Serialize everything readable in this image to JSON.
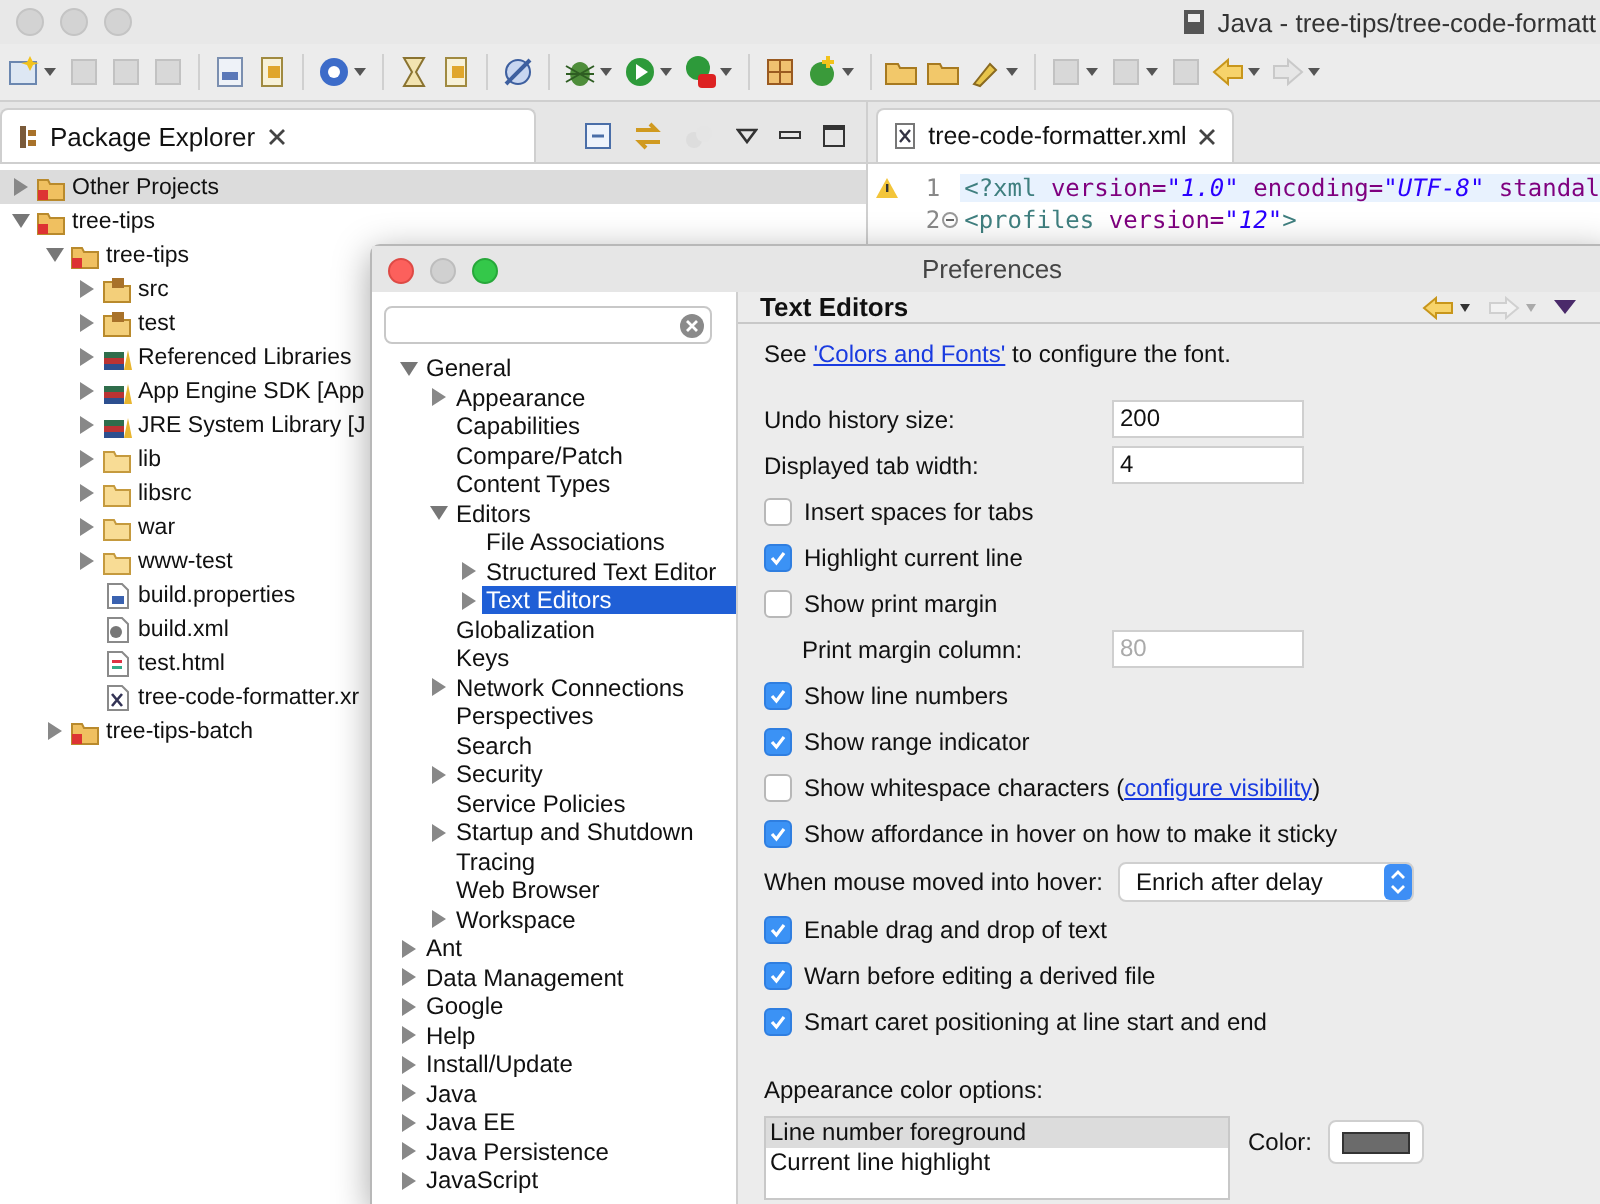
{
  "window": {
    "title": "Java - tree-tips/tree-code-formatt"
  },
  "package_explorer": {
    "title": "Package Explorer",
    "tree": [
      {
        "label": "Other Projects",
        "kind": "working-set",
        "expanded": false,
        "selected": true
      },
      {
        "label": "tree-tips",
        "kind": "working-set",
        "expanded": true,
        "selected": false,
        "children": [
          {
            "label": "tree-tips",
            "kind": "project",
            "expanded": true,
            "selected": false,
            "children": [
              {
                "label": "src",
                "kind": "source-folder",
                "expanded": false,
                "selected": false
              },
              {
                "label": "test",
                "kind": "source-folder",
                "expanded": false,
                "selected": false
              },
              {
                "label": "Referenced Libraries",
                "kind": "library",
                "expanded": false,
                "selected": false
              },
              {
                "label": "App Engine SDK [App",
                "kind": "library",
                "expanded": false,
                "selected": false
              },
              {
                "label": "JRE System Library [J",
                "kind": "library",
                "expanded": false,
                "selected": false
              },
              {
                "label": "lib",
                "kind": "folder",
                "expanded": false,
                "selected": false
              },
              {
                "label": "libsrc",
                "kind": "folder",
                "expanded": false,
                "selected": false
              },
              {
                "label": "war",
                "kind": "folder",
                "expanded": false,
                "selected": false
              },
              {
                "label": "www-test",
                "kind": "folder",
                "expanded": false,
                "selected": false
              },
              {
                "label": "build.properties",
                "kind": "properties-file",
                "selected": false
              },
              {
                "label": "build.xml",
                "kind": "build-file",
                "selected": false
              },
              {
                "label": "test.html",
                "kind": "html-file",
                "selected": false
              },
              {
                "label": "tree-code-formatter.xr",
                "kind": "xml-file",
                "selected": false
              }
            ]
          },
          {
            "label": "tree-tips-batch",
            "kind": "project",
            "expanded": false,
            "selected": false
          }
        ]
      }
    ]
  },
  "editor": {
    "tab": "tree-code-formatter.xml",
    "lines": [
      {
        "number": "1",
        "highlighted": true,
        "warning": true,
        "foldable": false,
        "tokens": [
          {
            "text": "<?xml",
            "kind": "tag"
          },
          {
            "text": " version=",
            "kind": "attr"
          },
          {
            "text": "\"1.0\"",
            "kind": "string"
          },
          {
            "text": " encoding=",
            "kind": "attr"
          },
          {
            "text": "\"UTF-8\"",
            "kind": "string"
          },
          {
            "text": " standal",
            "kind": "attr"
          }
        ]
      },
      {
        "number": "2",
        "highlighted": false,
        "warning": false,
        "foldable": true,
        "tokens": [
          {
            "text": "<profiles",
            "kind": "tag"
          },
          {
            "text": " version=",
            "kind": "attr"
          },
          {
            "text": "\"12\"",
            "kind": "string"
          },
          {
            "text": ">",
            "kind": "tag"
          }
        ]
      }
    ]
  },
  "preferences": {
    "title": "Preferences",
    "tree": [
      {
        "label": "General",
        "expanded": true,
        "selected": false,
        "children": [
          {
            "label": "Appearance",
            "expanded": false,
            "selected": false
          },
          {
            "label": "Capabilities",
            "selected": false
          },
          {
            "label": "Compare/Patch",
            "selected": false
          },
          {
            "label": "Content Types",
            "selected": false
          },
          {
            "label": "Editors",
            "expanded": true,
            "selected": false,
            "children": [
              {
                "label": "File Associations",
                "selected": false
              },
              {
                "label": "Structured Text Editor",
                "expanded": false,
                "selected": false
              },
              {
                "label": "Text Editors",
                "expanded": false,
                "selected": true
              }
            ]
          },
          {
            "label": "Globalization",
            "selected": false
          },
          {
            "label": "Keys",
            "selected": false
          },
          {
            "label": "Network Connections",
            "expanded": false,
            "selected": false
          },
          {
            "label": "Perspectives",
            "selected": false
          },
          {
            "label": "Search",
            "selected": false
          },
          {
            "label": "Security",
            "expanded": false,
            "selected": false
          },
          {
            "label": "Service Policies",
            "selected": false
          },
          {
            "label": "Startup and Shutdown",
            "expanded": false,
            "selected": false
          },
          {
            "label": "Tracing",
            "selected": false
          },
          {
            "label": "Web Browser",
            "selected": false
          },
          {
            "label": "Workspace",
            "expanded": false,
            "selected": false
          }
        ]
      },
      {
        "label": "Ant",
        "expanded": false,
        "selected": false
      },
      {
        "label": "Data Management",
        "expanded": false,
        "selected": false
      },
      {
        "label": "Google",
        "expanded": false,
        "selected": false
      },
      {
        "label": "Help",
        "expanded": false,
        "selected": false
      },
      {
        "label": "Install/Update",
        "expanded": false,
        "selected": false
      },
      {
        "label": "Java",
        "expanded": false,
        "selected": false
      },
      {
        "label": "Java EE",
        "expanded": false,
        "selected": false
      },
      {
        "label": "Java Persistence",
        "expanded": false,
        "selected": false
      },
      {
        "label": "JavaScript",
        "expanded": false,
        "selected": false
      }
    ],
    "page": {
      "title": "Text Editors",
      "intro": {
        "before": "See ",
        "link": "'Colors and Fonts'",
        "after": " to configure the font."
      },
      "settings": [
        {
          "kind": "field",
          "label": "Undo history size:",
          "value": "200"
        },
        {
          "kind": "field",
          "label": "Displayed tab width:",
          "value": "4"
        },
        {
          "kind": "checkbox",
          "label": "Insert spaces for tabs",
          "checked": false
        },
        {
          "kind": "checkbox",
          "label": "Highlight current line",
          "checked": true
        },
        {
          "kind": "checkbox",
          "label": "Show print margin",
          "checked": false
        },
        {
          "kind": "dependent-field",
          "label": "Print margin column:",
          "value": "80"
        },
        {
          "kind": "checkbox",
          "label": "Show line numbers",
          "checked": true
        },
        {
          "kind": "checkbox",
          "label": "Show range indicator",
          "checked": true
        },
        {
          "kind": "checkbox",
          "label": "Show whitespace characters (",
          "link": "configure visibility",
          "after": ")",
          "checked": false
        },
        {
          "kind": "checkbox",
          "label": "Show affordance in hover on how to make it sticky",
          "checked": true
        },
        {
          "kind": "select",
          "label": "When mouse moved into hover:",
          "value": "Enrich after delay"
        },
        {
          "kind": "checkbox",
          "label": "Enable drag and drop of text",
          "checked": true
        },
        {
          "kind": "checkbox",
          "label": "Warn before editing a derived file",
          "checked": true
        },
        {
          "kind": "checkbox",
          "label": "Smart caret positioning at line start and end",
          "checked": true
        }
      ],
      "color_options": {
        "label": "Appearance color options:",
        "items": [
          {
            "label": "Line number foreground",
            "selected": true
          },
          {
            "label": "Current line highlight",
            "selected": false
          }
        ],
        "color_label": "Color:",
        "color": "#6b6b6b"
      }
    }
  }
}
